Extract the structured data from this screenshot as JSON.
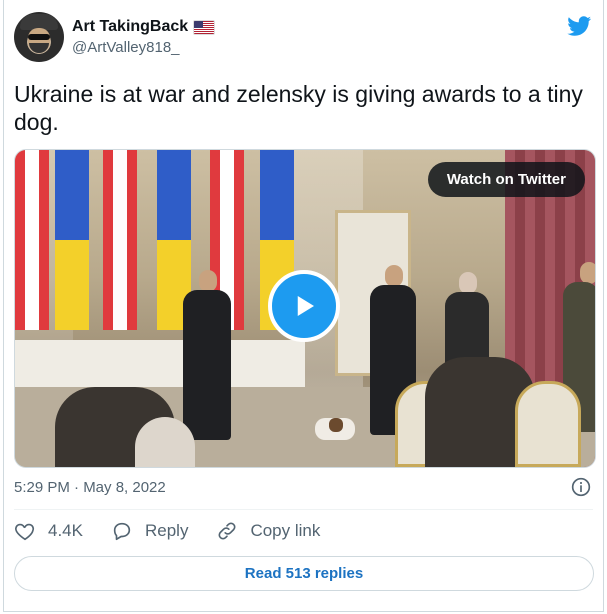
{
  "author": {
    "display_name": "Art TakingBack",
    "handle": "@ArtValley818_",
    "flag_icon": "us-flag-icon"
  },
  "brand": {
    "logo_icon": "twitter-bird-icon",
    "color": "#1d9bf0"
  },
  "tweet": {
    "text": "Ukraine is at war and zelensky is giving awards to a tiny dog."
  },
  "media": {
    "overlay_label": "Watch on Twitter",
    "play_icon": "play-icon"
  },
  "meta": {
    "timestamp": "5:29 PM · May 8, 2022",
    "info_icon": "info-icon"
  },
  "actions": {
    "like_count": "4.4K",
    "reply_label": "Reply",
    "copy_link_label": "Copy link"
  },
  "footer": {
    "read_replies_label": "Read 513 replies",
    "link_color": "#1d73c2"
  }
}
